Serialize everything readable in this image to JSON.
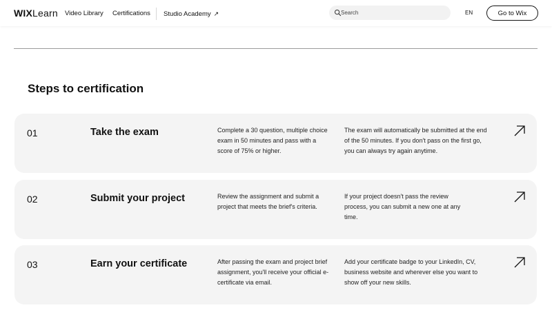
{
  "header": {
    "logo_wix": "WIX",
    "logo_learn": "Learn",
    "nav": {
      "video_library": "Video Library",
      "certifications": "Certifications",
      "studio_academy": "Studio Academy",
      "studio_arrow": "↗"
    },
    "search_placeholder": "Search",
    "language": "EN",
    "cta_label": "Go to Wix"
  },
  "section": {
    "title": "Steps to certification"
  },
  "steps": [
    {
      "number": "01",
      "title": "Take the exam",
      "text1": "Complete a 30 question, multiple choice exam in 50 minutes and pass with a score of 75% or higher.",
      "text2": "The exam will automatically be submitted at the end of the 50 minutes. If you don't pass on the first go, you can always try again anytime."
    },
    {
      "number": "02",
      "title": "Submit your project",
      "text1": "Review the assignment and submit a project that meets the brief's criteria.",
      "text2": "If your project doesn't pass the review process, you can submit a new one at any time."
    },
    {
      "number": "03",
      "title": "Earn your certificate",
      "text1": "After passing the exam and project brief assignment, you'll receive your official e-certificate via email.",
      "text2": "Add your certificate badge to your LinkedIn, CV, business website and wherever else you want to show off your new skills."
    }
  ],
  "icons": {
    "search": "search-icon",
    "step_arrow": "arrow-up-right-icon"
  },
  "colors": {
    "text": "#111111",
    "card_bg": "#f4f4f4",
    "search_bg": "#f2f2f2"
  }
}
